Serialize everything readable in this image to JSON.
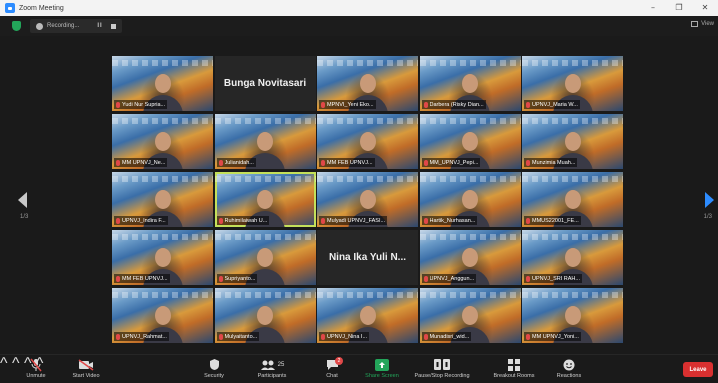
{
  "window": {
    "title": "Zoom Meeting",
    "controls": [
      "–",
      "❐",
      "✕"
    ]
  },
  "topbar": {
    "recording_label": "Recording...",
    "pause_label": "II",
    "view_label": "View"
  },
  "tiles": [
    {
      "label": "Yudi Nur Supria...",
      "kind": "video",
      "active": false
    },
    {
      "label": "",
      "kind": "name",
      "big": "Bunga Novitasari",
      "active": false
    },
    {
      "label": "MPNVI_Yeni Eko...",
      "kind": "video",
      "active": false
    },
    {
      "label": "Darbera (Risky Dian...",
      "kind": "video",
      "active": false
    },
    {
      "label": "UPNVJ_Maria W...",
      "kind": "video",
      "active": false
    },
    {
      "label": "MM UPNVJ_Ne...",
      "kind": "video",
      "active": false
    },
    {
      "label": "Julianidah...",
      "kind": "video",
      "active": false
    },
    {
      "label": "MM FEB UPNVJ...",
      "kind": "video",
      "active": false
    },
    {
      "label": "MM_UPNVJ_Pepi...",
      "kind": "video",
      "active": false
    },
    {
      "label": "Munzimia Muah...",
      "kind": "video",
      "active": false
    },
    {
      "label": "UPNVJ_Indira F...",
      "kind": "video",
      "active": false
    },
    {
      "label": "Ruhimilaiwah U...",
      "kind": "video",
      "active": true
    },
    {
      "label": "Mulyadi UPNVJ_FASI...",
      "kind": "video",
      "active": false
    },
    {
      "label": "Hartik_Nurhasan...",
      "kind": "video",
      "active": false
    },
    {
      "label": "MMUS22001_FE...",
      "kind": "video",
      "active": false
    },
    {
      "label": "MM FEB UPNVJ...",
      "kind": "video",
      "active": false
    },
    {
      "label": "Supriyanto...",
      "kind": "video",
      "active": false
    },
    {
      "label": "",
      "kind": "name",
      "big": "Nina Ika Yuli N...",
      "active": false
    },
    {
      "label": "UPNVJ_Anggun...",
      "kind": "video",
      "active": false
    },
    {
      "label": "UPNVJ_SRI RAH...",
      "kind": "video",
      "active": false
    },
    {
      "label": "UPNVJ_Rahmat...",
      "kind": "video",
      "active": false
    },
    {
      "label": "Mulyaitanto...",
      "kind": "video",
      "active": false
    },
    {
      "label": "UPNVJ_Nina I...",
      "kind": "video",
      "active": false
    },
    {
      "label": "Munadisri_wid...",
      "kind": "video",
      "active": false
    },
    {
      "label": "MM UPNVJ_Yoni...",
      "kind": "video",
      "active": false
    }
  ],
  "pager": {
    "left": "1/3",
    "right": "1/3"
  },
  "toolbar": {
    "unmute": "Unmute",
    "start_video": "Start Video",
    "security": "Security",
    "participants": "Participants",
    "participants_count": "25",
    "chat": "Chat",
    "chat_badge": "2",
    "share_screen": "Share Screen",
    "pause_recording": "Pause/Stop Recording",
    "breakout_rooms": "Breakout Rooms",
    "reactions": "Reactions",
    "leave": "Leave"
  },
  "colors": {
    "accent": "#2d8cff",
    "share_green": "#23a55a",
    "leave_red": "#d93030",
    "active_outline": "#c4e05a"
  }
}
